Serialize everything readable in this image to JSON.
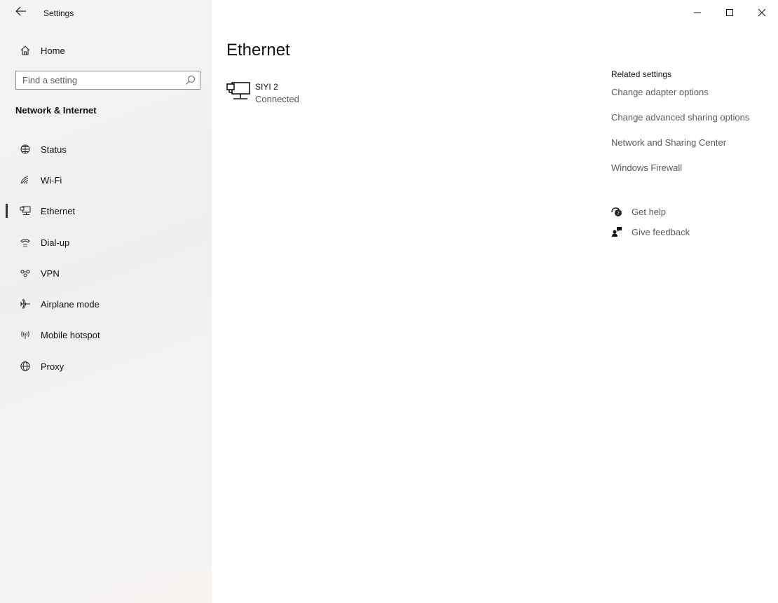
{
  "window": {
    "title": "Settings",
    "controls": [
      "minimize",
      "maximize",
      "close"
    ]
  },
  "sidebar": {
    "home_label": "Home",
    "search": {
      "placeholder": "Find a setting",
      "value": ""
    },
    "section_heading": "Network & Internet",
    "items": [
      {
        "label": "Status",
        "icon": "globe-status-icon"
      },
      {
        "label": "Wi-Fi",
        "icon": "wifi-icon"
      },
      {
        "label": "Ethernet",
        "icon": "ethernet-icon",
        "selected": true
      },
      {
        "label": "Dial-up",
        "icon": "dialup-icon"
      },
      {
        "label": "VPN",
        "icon": "vpn-icon"
      },
      {
        "label": "Airplane mode",
        "icon": "airplane-icon"
      },
      {
        "label": "Mobile hotspot",
        "icon": "hotspot-icon"
      },
      {
        "label": "Proxy",
        "icon": "globe-icon"
      }
    ]
  },
  "main": {
    "title": "Ethernet",
    "device": {
      "name": "SIYI 2",
      "status": "Connected",
      "icon": "ethernet-monitor-icon"
    }
  },
  "related": {
    "title": "Related settings",
    "links": [
      "Change adapter options",
      "Change advanced sharing options",
      "Network and Sharing Center",
      "Windows Firewall"
    ],
    "help": {
      "label": "Get help",
      "icon": "help-chat-icon"
    },
    "feedback": {
      "label": "Give feedback",
      "icon": "feedback-person-icon"
    }
  },
  "colors": {
    "accent_bar": "#333333",
    "link": "#5a5a5a",
    "sidebar_bg": "#f2f2f2"
  }
}
